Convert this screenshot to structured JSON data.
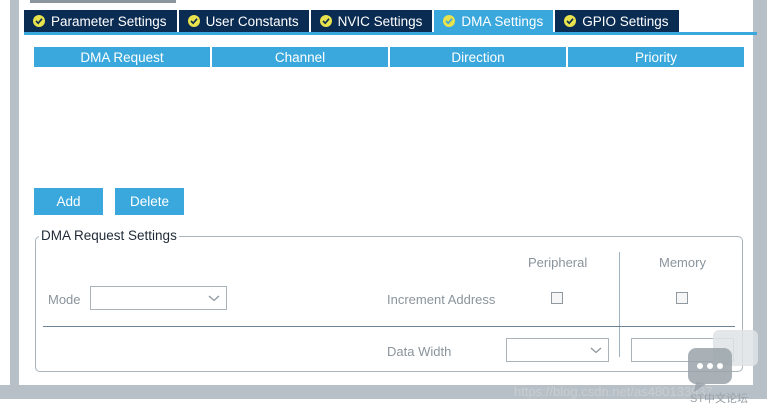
{
  "tabs": [
    {
      "label": "Parameter Settings",
      "active": false
    },
    {
      "label": "User Constants",
      "active": false
    },
    {
      "label": "NVIC Settings",
      "active": false
    },
    {
      "label": "DMA Settings",
      "active": true
    },
    {
      "label": "GPIO Settings",
      "active": false
    }
  ],
  "table": {
    "columns": [
      "DMA Request",
      "Channel",
      "Direction",
      "Priority"
    ],
    "rows": []
  },
  "buttons": {
    "add_label": "Add",
    "delete_label": "Delete"
  },
  "request_settings": {
    "title": "DMA Request Settings",
    "peripheral_label": "Peripheral",
    "memory_label": "Memory",
    "mode_label": "Mode",
    "mode_value": "",
    "increment_address_label": "Increment Address",
    "peripheral_increment_checked": false,
    "memory_increment_checked": false,
    "data_width_label": "Data Width",
    "peripheral_data_width_value": "",
    "memory_data_width_value": ""
  },
  "overlay": {
    "watermark": "https://blog.csdn.net/as480133937",
    "forum_label": "ST中文论坛"
  },
  "colors": {
    "tab_bg": "#0b2c52",
    "accent": "#3aa8dc",
    "check_badge": "#e8e24c",
    "frame": "#b7c0c7"
  },
  "icons": {
    "tab_status": "check-circle-icon",
    "select": "chevron-down-icon",
    "forum": "chat-bubble-icon"
  }
}
